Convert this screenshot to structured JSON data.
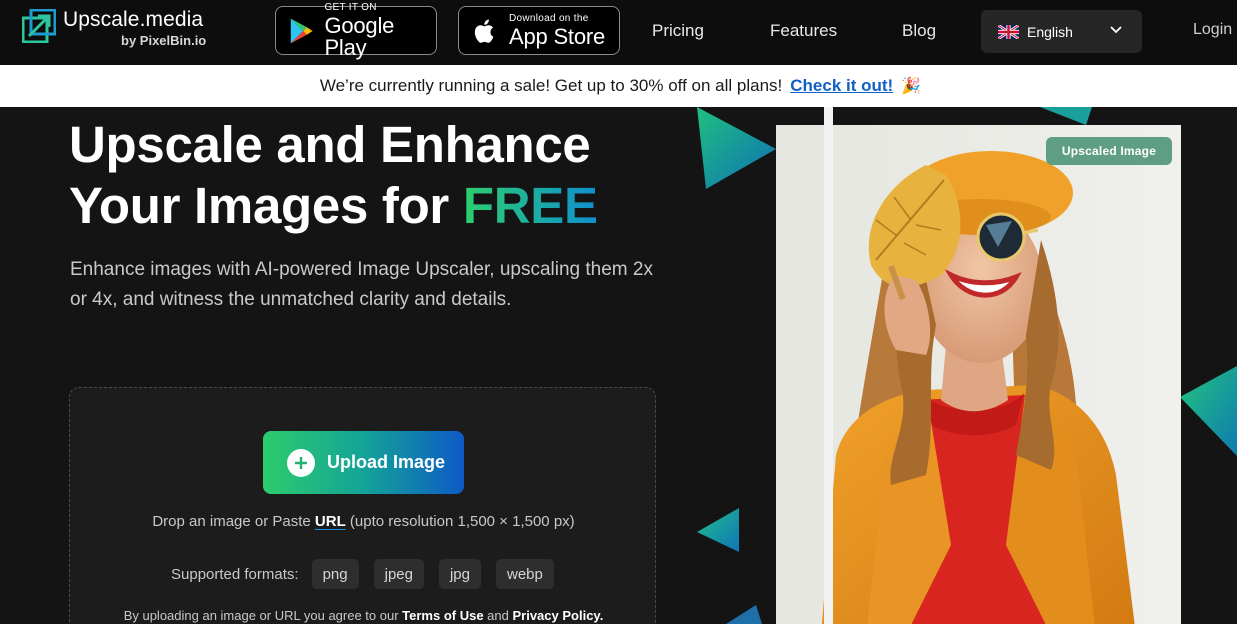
{
  "header": {
    "logo_name": "Upscale.media",
    "logo_sub": "by PixelBin.io",
    "google_play": {
      "small": "GET IT ON",
      "big": "Google Play"
    },
    "app_store": {
      "small": "Download on the",
      "big": "App Store"
    },
    "nav": {
      "pricing": "Pricing",
      "features": "Features",
      "blog": "Blog",
      "login": "Login"
    },
    "language": {
      "selected": "English",
      "icon": "uk-flag-icon"
    }
  },
  "banner": {
    "text": "We’re currently running a sale! Get up to 30% off on all plans!",
    "link": "Check it out!",
    "emoji": "🎉"
  },
  "hero": {
    "title_line1": "Upscale and Enhance",
    "title_line2_prefix": "Your Images for ",
    "title_highlight": "FREE",
    "subtitle": "Enhance images with AI-powered Image Upscaler, upscaling them 2x or 4x, and witness the unmatched clarity and details."
  },
  "upload": {
    "button_label": "Upload Image",
    "drop_prefix": "Drop an image or Paste ",
    "url_link": "URL",
    "drop_suffix": " (upto resolution 1,500 × 1,500 px)",
    "formats_label": "Supported formats:",
    "formats": [
      "png",
      "jpeg",
      "jpg",
      "webp"
    ],
    "terms_prefix": "By uploading an image or URL you agree to our ",
    "terms_link": "Terms of Use",
    "terms_and": " and ",
    "privacy_link": "Privacy Policy."
  },
  "preview": {
    "badge": "Upscaled Image"
  },
  "colors": {
    "accent_green": "#2dcc6c",
    "accent_blue": "#0d5ac6",
    "link_blue": "#1060c8",
    "background": "#141414"
  }
}
